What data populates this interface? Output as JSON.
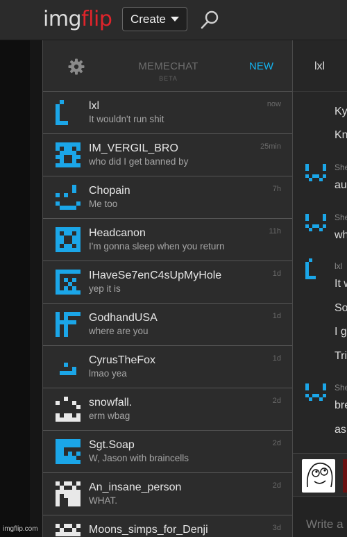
{
  "header": {
    "logo_left": "img",
    "logo_right": "flip",
    "create_label": "Create"
  },
  "chat_panel": {
    "title": "MEMECHAT",
    "subtitle": "BETA",
    "new_label": "NEW",
    "chats": [
      {
        "name": "lxl",
        "message": "It wouldn't run shit",
        "time": "now",
        "avatar_color": "#1ba6e8"
      },
      {
        "name": "IM_VERGIL_BRO",
        "message": "who did I get banned by",
        "time": "25min",
        "avatar_color": "#1ba6e8"
      },
      {
        "name": "Chopain",
        "message": "Me too",
        "time": "7h",
        "avatar_color": "#1ba6e8"
      },
      {
        "name": "Headcanon",
        "message": "I'm gonna sleep when you return",
        "time": "11h",
        "avatar_color": "#1ba6e8"
      },
      {
        "name": "IHaveSe7enC4sUpMyHole",
        "message": "yep it is",
        "time": "1d",
        "avatar_color": "#1ba6e8"
      },
      {
        "name": "GodhandUSA",
        "message": "where are you",
        "time": "1d",
        "avatar_color": "#1ba6e8"
      },
      {
        "name": "CyrusTheFox",
        "message": "lmao yea",
        "time": "1d",
        "avatar_color": "#1ba6e8"
      },
      {
        "name": "snowfall.",
        "message": "erm wbag",
        "time": "2d",
        "avatar_color": "#e8e8e8"
      },
      {
        "name": "Sgt.Soap",
        "message": "W, Jason with braincells",
        "time": "2d",
        "avatar_color": "#1ba6e8"
      },
      {
        "name": "An_insane_person",
        "message": "WHAT.",
        "time": "2d",
        "avatar_color": "#e8e8e8"
      },
      {
        "name": "Moons_simps_for_Denji",
        "message": "",
        "time": "3d",
        "avatar_color": "#e8e8e8"
      }
    ]
  },
  "conversation": {
    "title": "lxl",
    "lines": [
      "Ky",
      "Kn",
      "au",
      "wh",
      "It w",
      "So",
      "I g",
      "Tri",
      "bre",
      "as"
    ],
    "senders": [
      "She",
      "She",
      "lxl",
      "She"
    ],
    "input_placeholder": "Write a"
  },
  "watermark": "imgflip.com",
  "colors": {
    "accent": "#13b3f0",
    "brand_red": "#e0242b",
    "avatar_blue": "#1ba6e8"
  }
}
